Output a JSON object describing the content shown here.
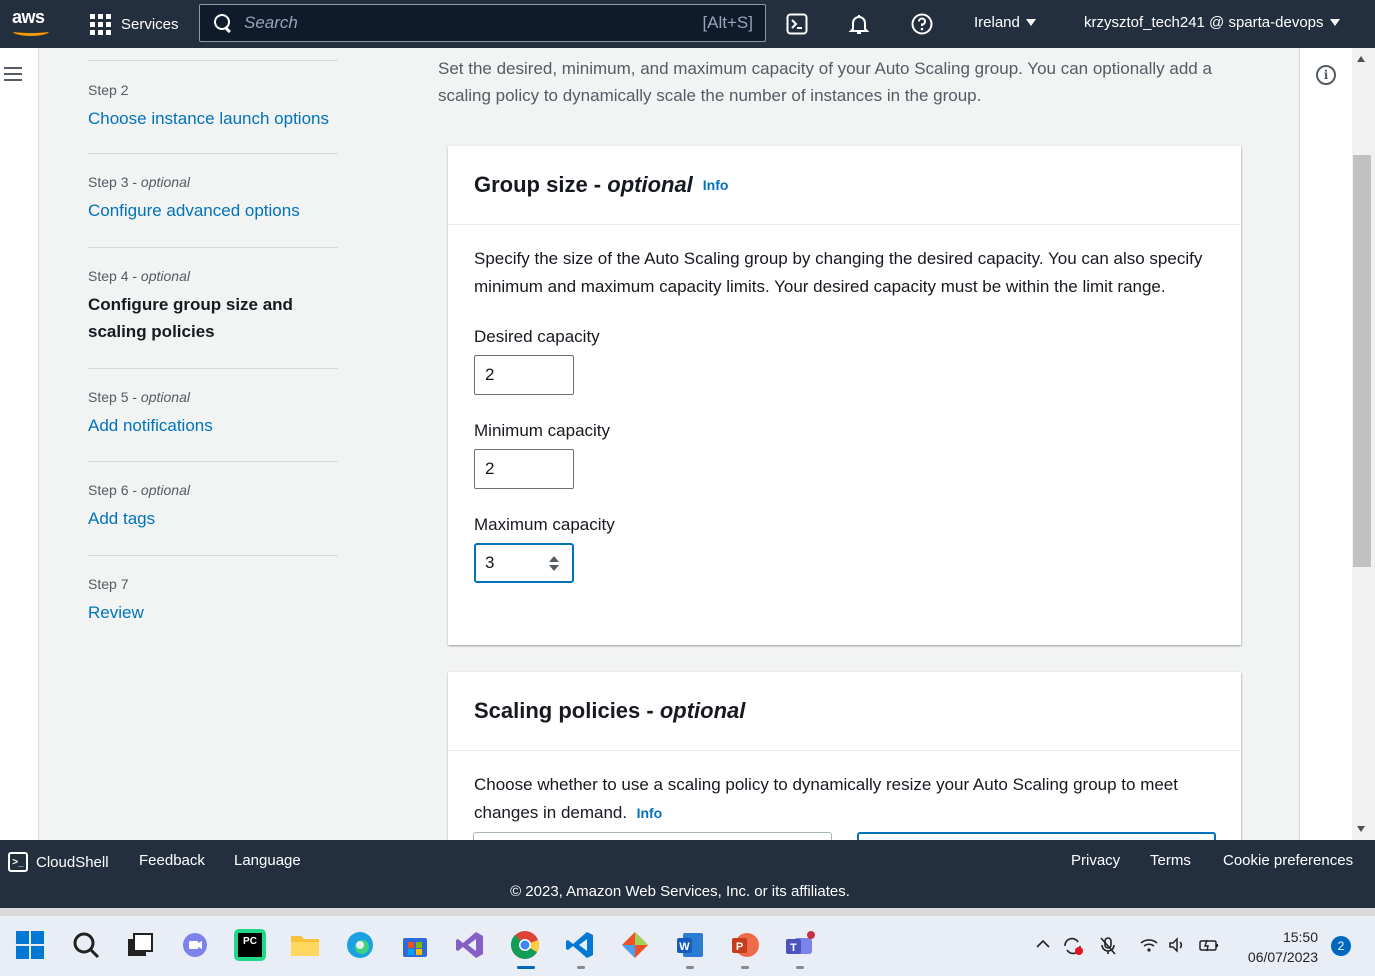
{
  "topnav": {
    "logo": "aws",
    "services_label": "Services",
    "search_placeholder": "Search",
    "search_shortcut": "[Alt+S]",
    "region": "Ireland",
    "account": "krzysztof_tech241 @ sparta-devops"
  },
  "steps": [
    {
      "step": "Step 2",
      "optional": "",
      "label": "Choose instance launch options",
      "current": false
    },
    {
      "step": "Step 3 - ",
      "optional": "optional",
      "label": "Configure advanced options",
      "current": false
    },
    {
      "step": "Step 4 - ",
      "optional": "optional",
      "label": "Configure group size and scaling policies",
      "current": true
    },
    {
      "step": "Step 5 - ",
      "optional": "optional",
      "label": "Add notifications",
      "current": false
    },
    {
      "step": "Step 6 - ",
      "optional": "optional",
      "label": "Add tags",
      "current": false
    },
    {
      "step": "Step 7",
      "optional": "",
      "label": "Review",
      "current": false
    }
  ],
  "main": {
    "intro": "Set the desired, minimum, and maximum capacity of your Auto Scaling group. You can optionally add a scaling policy to dynamically scale the number of instances in the group.",
    "group_size": {
      "title": "Group size - ",
      "title_optional": "optional",
      "info": "Info",
      "description": "Specify the size of the Auto Scaling group by changing the desired capacity. You can also specify minimum and maximum capacity limits. Your desired capacity must be within the limit range.",
      "desired_label": "Desired capacity",
      "desired_value": "2",
      "min_label": "Minimum capacity",
      "min_value": "2",
      "max_label": "Maximum capacity",
      "max_value": "3"
    },
    "scaling": {
      "title": "Scaling policies - ",
      "title_optional": "optional",
      "description": "Choose whether to use a scaling policy to dynamically resize your Auto Scaling group to meet changes in demand.",
      "info": "Info"
    }
  },
  "footer": {
    "cloudshell": "CloudShell",
    "feedback": "Feedback",
    "language": "Language",
    "privacy": "Privacy",
    "terms": "Terms",
    "cookie": "Cookie preferences",
    "copyright": "© 2023, Amazon Web Services, Inc. or its affiliates."
  },
  "taskbar": {
    "time": "15:50",
    "date": "06/07/2023",
    "notifications": "2",
    "apps": [
      "start-icon",
      "search-icon",
      "task-view-icon",
      "chat-icon",
      "pycharm-icon",
      "file-explorer-icon",
      "edge-icon",
      "store-icon",
      "visual-studio-icon",
      "chrome-icon",
      "vscode-icon",
      "git-icon",
      "word-icon",
      "powerpoint-icon",
      "teams-icon"
    ]
  },
  "colors": {
    "nav_bg": "#232f3e",
    "link": "#0073bb",
    "aws_orange": "#ff9900",
    "focus": "#0073bb"
  }
}
